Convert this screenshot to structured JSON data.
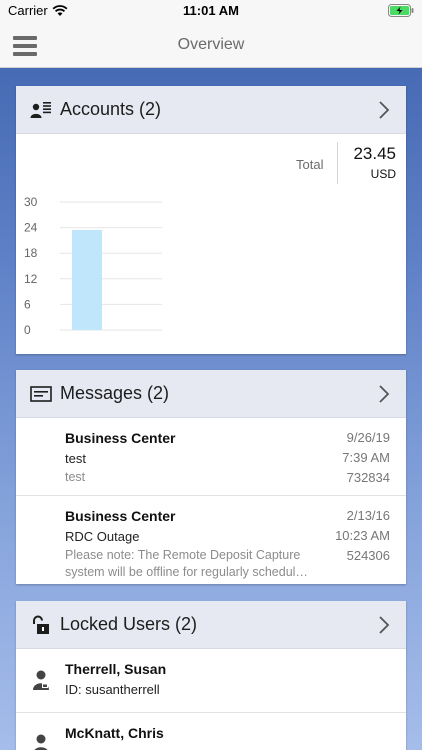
{
  "status_bar": {
    "carrier": "Carrier",
    "time": "11:01 AM"
  },
  "nav": {
    "title": "Overview",
    "menu_icon": "hamburger-menu-icon"
  },
  "accounts": {
    "title": "Accounts (2)",
    "total_label": "Total",
    "total_value": "23.45",
    "total_currency": "USD",
    "icon": "accounts-icon"
  },
  "chart_data": {
    "type": "bar",
    "categories": [
      ""
    ],
    "values": [
      23.45
    ],
    "ylim": [
      0,
      30
    ],
    "yticks": [
      "0",
      "6",
      "12",
      "18",
      "24",
      "30"
    ],
    "grid": true,
    "color": "#bfe6fb"
  },
  "messages": {
    "title": "Messages (2)",
    "icon": "message-icon",
    "items": [
      {
        "sender": "Business Center",
        "subject": "test",
        "preview": "test",
        "date": "9/26/19",
        "time": "7:39 AM",
        "id": "732834"
      },
      {
        "sender": "Business Center",
        "subject": "RDC Outage",
        "preview": "Please note: The Remote Deposit Capture system will be offline for regularly schedul…",
        "date": "2/13/16",
        "time": "10:23 AM",
        "id": "524306"
      }
    ]
  },
  "locked_users": {
    "title": "Locked Users (2)",
    "icon": "unlocked-padlock-icon",
    "items": [
      {
        "name": "Therrell, Susan",
        "id_line": "ID: susantherrell"
      },
      {
        "name": "McKnatt, Chris",
        "id_line": ""
      }
    ]
  },
  "colors": {
    "accent": "#3e63ad",
    "header_bg": "#e6e9f2",
    "bar": "#bfe6fb"
  }
}
